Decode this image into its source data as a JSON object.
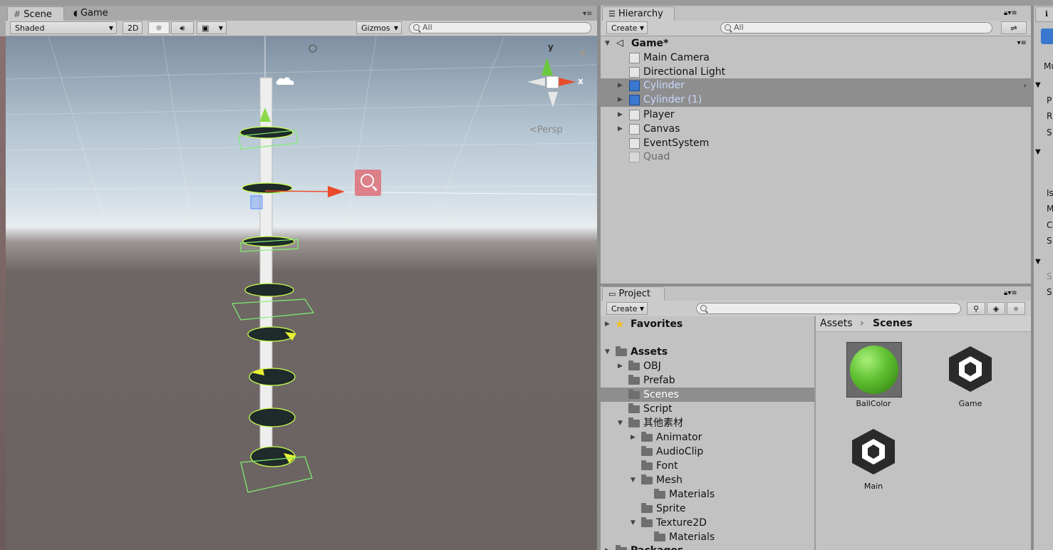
{
  "scene_panel": {
    "tabs": [
      {
        "label": "Scene"
      },
      {
        "label": "Game"
      }
    ],
    "toolbar": {
      "shading": "Shaded",
      "mode_2d": "2D",
      "gizmos": "Gizmos",
      "search_placeholder": "All"
    },
    "persp_label": "<Persp",
    "axis_y": "y",
    "axis_x": "x"
  },
  "hierarchy": {
    "tab_label": "Hierarchy",
    "create": "Create",
    "search_placeholder": "All",
    "scene_name": "Game*",
    "items": [
      {
        "label": "Main Camera"
      },
      {
        "label": "Directional Light"
      },
      {
        "label": "Cylinder"
      },
      {
        "label": "Cylinder (1)"
      },
      {
        "label": "Player"
      },
      {
        "label": "Canvas"
      },
      {
        "label": "EventSystem"
      },
      {
        "label": "Quad"
      }
    ]
  },
  "project": {
    "tab_label": "Project",
    "create": "Create",
    "favorites": "Favorites",
    "tree": [
      {
        "label": "Assets"
      },
      {
        "label": "OBJ"
      },
      {
        "label": "Prefab"
      },
      {
        "label": "Scenes"
      },
      {
        "label": "Script"
      },
      {
        "label": "其他素材"
      },
      {
        "label": "Animator"
      },
      {
        "label": "AudioClip"
      },
      {
        "label": "Font"
      },
      {
        "label": "Mesh"
      },
      {
        "label": "Materials"
      },
      {
        "label": "Sprite"
      },
      {
        "label": "Texture2D"
      },
      {
        "label": "Materials"
      },
      {
        "label": "Packages"
      }
    ],
    "breadcrumb": [
      "Assets",
      "Scenes"
    ],
    "assets": [
      {
        "label": "BallColor"
      },
      {
        "label": "Game"
      },
      {
        "label": "Main"
      }
    ]
  },
  "inspector": {
    "letters": [
      "Mu",
      "P",
      "R",
      "S",
      "Is",
      "M",
      "C",
      "S",
      "S",
      "S"
    ]
  },
  "colors": {
    "selection": "#8e8e8e",
    "sky": "#c9d7e0",
    "ground": "#6e6664",
    "ball": "#5fbf2f"
  }
}
